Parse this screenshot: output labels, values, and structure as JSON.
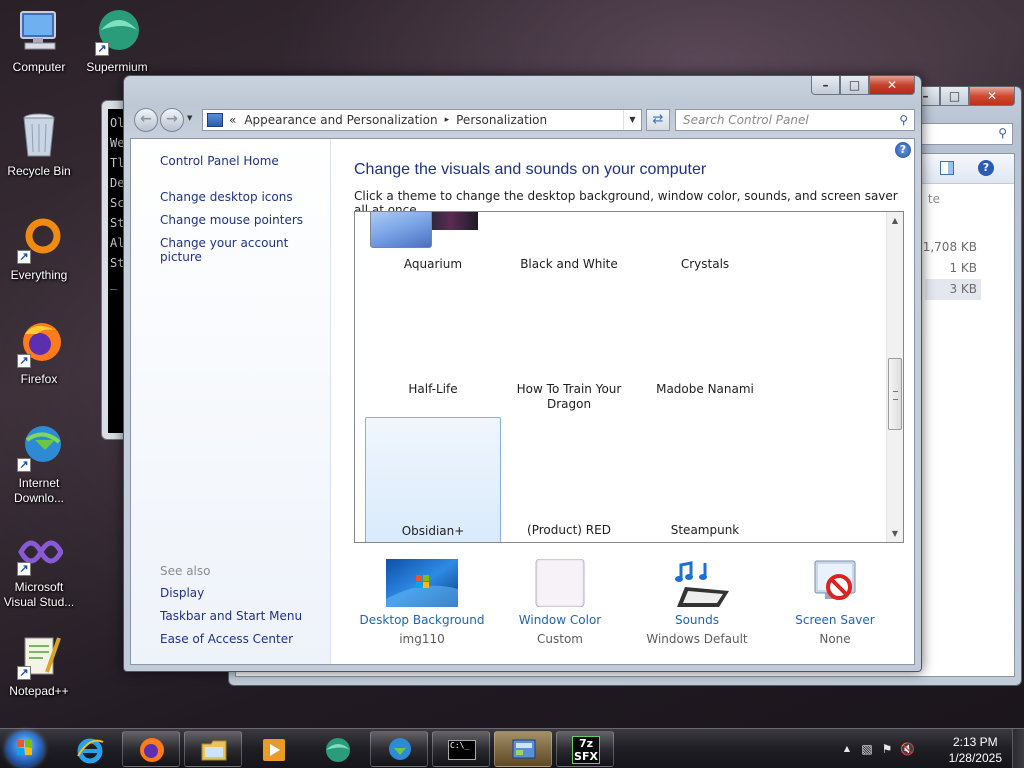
{
  "desktop": {
    "icons": [
      {
        "label": "Computer"
      },
      {
        "label": "Supermium"
      },
      {
        "label": "Recycle Bin"
      },
      {
        "label": "Everything"
      },
      {
        "label": "Firefox"
      },
      {
        "label": "Internet Downlo..."
      },
      {
        "label": "Microsoft Visual Stud..."
      },
      {
        "label": "Notepad++"
      }
    ]
  },
  "cmd_window": {
    "lines": [
      "Ol",
      "We",
      "Tl",
      "De",
      "Sc",
      "St",
      "Al",
      "St",
      "_"
    ]
  },
  "explorer_window": {
    "sizes": [
      "1,708 KB",
      "1 KB",
      "3 KB"
    ],
    "partial_text": "te"
  },
  "window": {
    "caption": {
      "minimize": "–",
      "maximize": "□",
      "close": "✕"
    },
    "breadcrumb": {
      "chevron": "«",
      "parent": "Appearance and Personalization",
      "separator": "▸",
      "current": "Personalization"
    },
    "search": {
      "placeholder": "Search Control Panel"
    },
    "sidebar": {
      "home": "Control Panel Home",
      "links": [
        "Change desktop icons",
        "Change mouse pointers",
        "Change your account picture"
      ],
      "see_also": "See also",
      "see_also_links": [
        "Display",
        "Taskbar and Start Menu",
        "Ease of Access Center"
      ]
    },
    "main": {
      "title": "Change the visuals and sounds on your computer",
      "description": "Click a theme to change the desktop background, window color, sounds, and screen saver all at once.",
      "themes": [
        {
          "name": "Aquarium"
        },
        {
          "name": "Black and White"
        },
        {
          "name": "Crystals"
        },
        {
          "name": "Half-Life"
        },
        {
          "name": "How To Train Your Dragon"
        },
        {
          "name": "Madobe Nanami"
        },
        {
          "name": "Obsidian+"
        },
        {
          "name": "(Product) RED"
        },
        {
          "name": "Steampunk"
        }
      ],
      "selected_theme": "Obsidian+"
    },
    "bottom": [
      {
        "title": "Desktop Background",
        "value": "img110",
        "icon": "desktop-background-icon"
      },
      {
        "title": "Window Color",
        "value": "Custom",
        "icon": "window-color-icon"
      },
      {
        "title": "Sounds",
        "value": "Windows Default",
        "icon": "sounds-icon"
      },
      {
        "title": "Screen Saver",
        "value": "None",
        "icon": "screen-saver-icon"
      }
    ]
  },
  "taskbar": {
    "apps": [
      "internet-explorer",
      "firefox",
      "file-explorer",
      "media-player",
      "supermium",
      "internet-download-manager",
      "command-prompt",
      "control-panel",
      "7zip-sfx"
    ],
    "cmd_label": "C:\\_",
    "sfx_label": "7z SFX",
    "clock": {
      "time": "2:13 PM",
      "date": "1/28/2025"
    }
  },
  "colors": {
    "link": "#1e3287",
    "accent_blue": "#1e64b4",
    "close_red": "#c7412c"
  }
}
